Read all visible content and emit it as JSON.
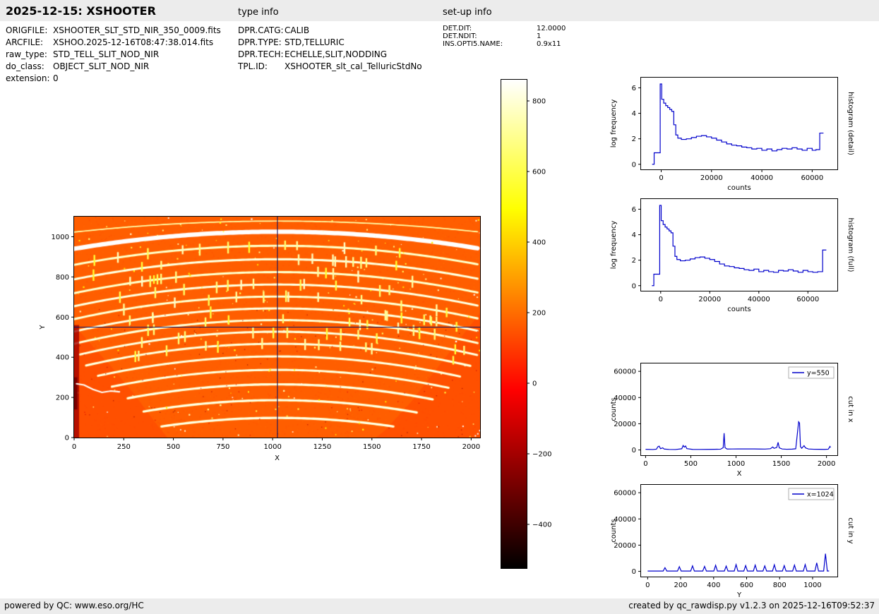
{
  "header": {
    "title": "2025-12-15: XSHOOTER",
    "type_info_label": "type info",
    "setup_info_label": "set-up info"
  },
  "metadata": {
    "left": [
      {
        "label": "ORIGFILE:",
        "value": "XSHOOTER_SLT_STD_NIR_350_0009.fits"
      },
      {
        "label": "ARCFILE:",
        "value": "XSHOO.2025-12-16T08:47:38.014.fits"
      },
      {
        "label": "raw_type:",
        "value": "STD_TELL_SLIT_NOD_NIR"
      },
      {
        "label": "do_class:",
        "value": "OBJECT_SLIT_NOD_NIR"
      },
      {
        "label": "extension:",
        "value": "0"
      }
    ],
    "middle": [
      {
        "label": "DPR.CATG:",
        "value": "CALIB"
      },
      {
        "label": "DPR.TYPE:",
        "value": "STD,TELLURIC"
      },
      {
        "label": "DPR.TECH:",
        "value": "ECHELLE,SLIT,NODDING"
      },
      {
        "label": "TPL.ID:",
        "value": "XSHOOTER_slt_cal_TelluricStdNo"
      }
    ],
    "right": [
      {
        "label": "DET.DIT:",
        "value": "12.0000"
      },
      {
        "label": "DET.NDIT:",
        "value": "1"
      },
      {
        "label": "INS.OPTI5.NAME:",
        "value": "0.9x11"
      }
    ]
  },
  "footer": {
    "left": "powered by QC: www.eso.org/HC",
    "right": "created by qc_rawdisp.py v1.2.3 on 2025-12-16T09:52:37"
  },
  "colors": {
    "line_blue": "#0000cc",
    "crosshair": "#151560",
    "bar_bg": "#ececec"
  },
  "chart_data": [
    {
      "id": "raw_image",
      "type": "heatmap",
      "xlabel": "X",
      "ylabel": "Y",
      "xlim": [
        0,
        2045
      ],
      "ylim": [
        0,
        1100
      ],
      "xticks": [
        0,
        250,
        500,
        750,
        1000,
        1250,
        1500,
        1750,
        2000
      ],
      "yticks": [
        0,
        200,
        400,
        600,
        800,
        1000
      ],
      "crosshair": {
        "x": 1024,
        "y": 550
      },
      "colormap": {
        "name": "hot",
        "vmin": -524,
        "vmax": 860
      },
      "background_value": 170,
      "orders": [
        {
          "yc": 1078,
          "sag": 55,
          "x0": 0,
          "x1": 2045,
          "value": 690,
          "thickness": 6
        },
        {
          "yc": 1025,
          "sag": 85,
          "x0": 0,
          "x1": 2045,
          "value": 880,
          "thickness": 22
        },
        {
          "yc": 955,
          "sag": 95,
          "x0": 0,
          "x1": 2045,
          "value": 730,
          "thickness": 11
        },
        {
          "yc": 888,
          "sag": 100,
          "x0": 0,
          "x1": 2045,
          "value": 765,
          "thickness": 11
        },
        {
          "yc": 824,
          "sag": 105,
          "x0": 0,
          "x1": 2045,
          "value": 735,
          "thickness": 11
        },
        {
          "yc": 762,
          "sag": 108,
          "x0": 0,
          "x1": 2045,
          "value": 765,
          "thickness": 11
        },
        {
          "yc": 702,
          "sag": 112,
          "x0": 0,
          "x1": 2045,
          "value": 745,
          "thickness": 11
        },
        {
          "yc": 643,
          "sag": 115,
          "x0": 0,
          "x1": 2045,
          "value": 765,
          "thickness": 11
        },
        {
          "yc": 585,
          "sag": 118,
          "x0": 0,
          "x1": 2045,
          "value": 750,
          "thickness": 11
        },
        {
          "yc": 527,
          "sag": 120,
          "x0": 30,
          "x1": 2045,
          "value": 765,
          "thickness": 11
        },
        {
          "yc": 467,
          "sag": 122,
          "x0": 60,
          "x1": 2000,
          "value": 760,
          "thickness": 11
        },
        {
          "yc": 404,
          "sag": 124,
          "x0": 120,
          "x1": 1950,
          "value": 765,
          "thickness": 11
        },
        {
          "yc": 337,
          "sag": 126,
          "x0": 190,
          "x1": 1890,
          "value": 760,
          "thickness": 11
        },
        {
          "yc": 265,
          "sag": 128,
          "x0": 270,
          "x1": 1820,
          "value": 765,
          "thickness": 12
        },
        {
          "yc": 186,
          "sag": 130,
          "x0": 350,
          "x1": 1730,
          "value": 760,
          "thickness": 12
        },
        {
          "yc": 98,
          "sag": 132,
          "x0": 440,
          "x1": 1620,
          "value": 765,
          "thickness": 12
        }
      ]
    },
    {
      "id": "colorbar",
      "type": "colorbar",
      "vmin": -524,
      "vmax": 860,
      "ticks": [
        800,
        600,
        400,
        200,
        0,
        -200,
        -400
      ]
    },
    {
      "id": "hist_detail",
      "type": "line",
      "style": "step",
      "right_label": "histogram (detail)",
      "xlabel": "counts",
      "ylabel": "log frequency",
      "xlim": [
        -8000,
        70000
      ],
      "ylim": [
        -0.4,
        6.8
      ],
      "xticks": [
        0,
        20000,
        40000,
        60000
      ],
      "yticks": [
        0,
        2,
        4,
        6
      ],
      "x": [
        -3600,
        -2800,
        -2000,
        -1200,
        -400,
        200,
        1000,
        1800,
        2600,
        3400,
        4200,
        5000,
        5800,
        6600,
        8000,
        10000,
        12000,
        14000,
        16000,
        18000,
        20000,
        22000,
        24000,
        26000,
        28000,
        30000,
        32000,
        34000,
        36000,
        38000,
        40000,
        42000,
        44000,
        46000,
        48000,
        50000,
        52000,
        54000,
        56000,
        58000,
        60000,
        61500,
        63000,
        64500
      ],
      "y": [
        0,
        0.9,
        0.9,
        0.9,
        6.3,
        5.1,
        4.8,
        4.6,
        4.45,
        4.3,
        4.15,
        3.1,
        2.3,
        2.05,
        1.95,
        2.0,
        2.1,
        2.2,
        2.25,
        2.15,
        2.05,
        1.9,
        1.75,
        1.6,
        1.5,
        1.45,
        1.35,
        1.3,
        1.2,
        1.25,
        1.1,
        1.2,
        1.05,
        1.15,
        1.25,
        1.2,
        1.3,
        1.2,
        1.1,
        1.25,
        1.1,
        1.15,
        2.45,
        2.45
      ]
    },
    {
      "id": "hist_full",
      "type": "line",
      "style": "step",
      "right_label": "histogram (full)",
      "xlabel": "counts",
      "ylabel": "log frequency",
      "xlim": [
        -8000,
        72000
      ],
      "ylim": [
        -0.4,
        6.8
      ],
      "xticks": [
        0,
        20000,
        40000,
        60000
      ],
      "yticks": [
        0,
        2,
        4,
        6
      ],
      "x": [
        -3600,
        -2800,
        -2000,
        -1200,
        -400,
        200,
        1000,
        1800,
        2600,
        3400,
        4200,
        5000,
        5800,
        6600,
        8000,
        10000,
        12000,
        14000,
        16000,
        18000,
        20000,
        22000,
        24000,
        26000,
        28000,
        30000,
        32000,
        34000,
        36000,
        38000,
        40000,
        42000,
        44000,
        46000,
        48000,
        50000,
        52000,
        54000,
        56000,
        58000,
        60000,
        62000,
        64000,
        66000,
        67500
      ],
      "y": [
        0,
        0.9,
        0.9,
        0.9,
        6.3,
        5.1,
        4.8,
        4.6,
        4.45,
        4.3,
        4.15,
        3.1,
        2.3,
        2.05,
        1.95,
        2.0,
        2.1,
        2.2,
        2.25,
        2.15,
        2.05,
        1.9,
        1.7,
        1.55,
        1.5,
        1.4,
        1.35,
        1.25,
        1.2,
        1.3,
        1.1,
        1.2,
        1.1,
        1.05,
        1.2,
        1.15,
        1.25,
        1.15,
        1.05,
        1.2,
        1.1,
        1.05,
        1.1,
        2.8,
        2.8
      ]
    },
    {
      "id": "cut_x",
      "type": "line",
      "style": "plain",
      "legend": "y=550",
      "right_label": "cut in x",
      "xlabel": "X",
      "ylabel": "counts",
      "xlim": [
        -50,
        2120
      ],
      "ylim": [
        -4000,
        66000
      ],
      "xticks": [
        0,
        500,
        1000,
        1500,
        2000
      ],
      "yticks": [
        0,
        20000,
        40000,
        60000
      ],
      "points": [
        [
          0,
          500
        ],
        [
          80,
          350
        ],
        [
          120,
          600
        ],
        [
          135,
          2400
        ],
        [
          150,
          2900
        ],
        [
          165,
          1000
        ],
        [
          190,
          1600
        ],
        [
          205,
          700
        ],
        [
          260,
          400
        ],
        [
          330,
          350
        ],
        [
          400,
          900
        ],
        [
          415,
          3400
        ],
        [
          428,
          2200
        ],
        [
          442,
          3000
        ],
        [
          456,
          1000
        ],
        [
          520,
          450
        ],
        [
          600,
          400
        ],
        [
          680,
          450
        ],
        [
          760,
          500
        ],
        [
          830,
          600
        ],
        [
          858,
          1800
        ],
        [
          868,
          12800
        ],
        [
          878,
          1800
        ],
        [
          900,
          700
        ],
        [
          960,
          750
        ],
        [
          1020,
          820
        ],
        [
          1080,
          760
        ],
        [
          1140,
          820
        ],
        [
          1200,
          780
        ],
        [
          1260,
          720
        ],
        [
          1320,
          680
        ],
        [
          1380,
          950
        ],
        [
          1405,
          2300
        ],
        [
          1420,
          1300
        ],
        [
          1450,
          1900
        ],
        [
          1465,
          5800
        ],
        [
          1478,
          1600
        ],
        [
          1510,
          750
        ],
        [
          1560,
          550
        ],
        [
          1620,
          650
        ],
        [
          1660,
          900
        ],
        [
          1692,
          21500
        ],
        [
          1702,
          20500
        ],
        [
          1712,
          2600
        ],
        [
          1726,
          1300
        ],
        [
          1752,
          3300
        ],
        [
          1768,
          1600
        ],
        [
          1800,
          750
        ],
        [
          1860,
          550
        ],
        [
          1920,
          500
        ],
        [
          1980,
          450
        ],
        [
          2020,
          600
        ],
        [
          2038,
          2700
        ],
        [
          2045,
          1900
        ]
      ]
    },
    {
      "id": "cut_y",
      "type": "line",
      "style": "peaks",
      "legend": "x=1024",
      "right_label": "cut in y",
      "xlabel": "Y",
      "ylabel": "counts",
      "xlim": [
        -40,
        1150
      ],
      "ylim": [
        -4000,
        66000
      ],
      "xticks": [
        0,
        200,
        400,
        600,
        800,
        1000
      ],
      "yticks": [
        0,
        20000,
        40000,
        60000
      ],
      "baseline": 260,
      "end": 1100,
      "peaks": [
        [
          105,
          2800
        ],
        [
          192,
          3600
        ],
        [
          272,
          4200
        ],
        [
          345,
          3800
        ],
        [
          412,
          4600
        ],
        [
          476,
          4000
        ],
        [
          536,
          5200
        ],
        [
          594,
          4400
        ],
        [
          652,
          4800
        ],
        [
          710,
          4200
        ],
        [
          768,
          5000
        ],
        [
          828,
          4400
        ],
        [
          890,
          4800
        ],
        [
          955,
          5200
        ],
        [
          1025,
          6500
        ],
        [
          1078,
          13500
        ]
      ]
    }
  ]
}
